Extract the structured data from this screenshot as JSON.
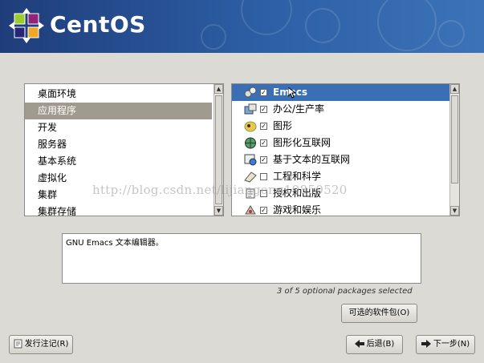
{
  "header": {
    "brand": "CentOS"
  },
  "categories": {
    "items": [
      {
        "label": "桌面环境",
        "selected": false
      },
      {
        "label": "应用程序",
        "selected": true
      },
      {
        "label": "开发",
        "selected": false
      },
      {
        "label": "服务器",
        "selected": false
      },
      {
        "label": "基本系统",
        "selected": false
      },
      {
        "label": "虚拟化",
        "selected": false
      },
      {
        "label": "集群",
        "selected": false
      },
      {
        "label": "集群存储",
        "selected": false
      }
    ]
  },
  "packages": {
    "items": [
      {
        "label": "Emacs",
        "checked": true,
        "selected": true,
        "icon": "emacs-icon"
      },
      {
        "label": "办公/生产率",
        "checked": true,
        "selected": false,
        "icon": "office-icon"
      },
      {
        "label": "图形",
        "checked": true,
        "selected": false,
        "icon": "graphics-icon"
      },
      {
        "label": "图形化互联网",
        "checked": true,
        "selected": false,
        "icon": "internet-icon"
      },
      {
        "label": "基于文本的互联网",
        "checked": true,
        "selected": false,
        "icon": "text-internet-icon"
      },
      {
        "label": "工程和科学",
        "checked": false,
        "selected": false,
        "icon": "engineering-icon"
      },
      {
        "label": "授权和出版",
        "checked": false,
        "selected": false,
        "icon": "publishing-icon"
      },
      {
        "label": "游戏和娱乐",
        "checked": true,
        "selected": false,
        "icon": "games-icon"
      }
    ]
  },
  "description": "GNU Emacs 文本编辑器。",
  "status": "3 of 5 optional packages selected",
  "buttons": {
    "optional": "可选的软件包(O)",
    "release_notes": "发行注记(R)",
    "back": "后退(B)",
    "next": "下一步(N)"
  },
  "watermark": "http://blog.csdn.net/lijiangong19850520",
  "colors": {
    "selection": "#3a6fb5",
    "category_selection": "#a09a8f",
    "banner": "#2d5fa6"
  }
}
